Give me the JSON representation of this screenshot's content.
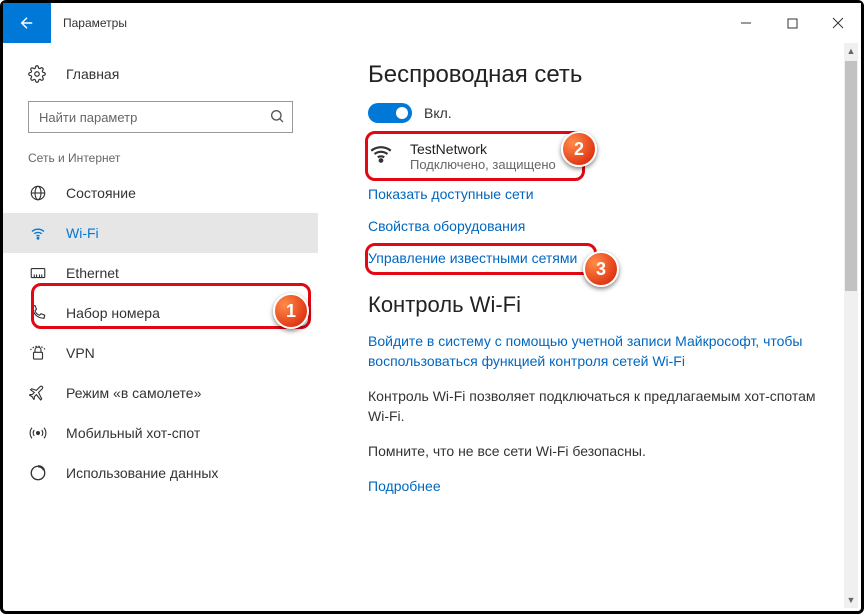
{
  "titlebar": {
    "title": "Параметры"
  },
  "sidebar": {
    "home_label": "Главная",
    "search_placeholder": "Найти параметр",
    "category_label": "Сеть и Интернет",
    "items": [
      {
        "label": "Состояние"
      },
      {
        "label": "Wi-Fi"
      },
      {
        "label": "Ethernet"
      },
      {
        "label": "Набор номера"
      },
      {
        "label": "VPN"
      },
      {
        "label": "Режим «в самолете»"
      },
      {
        "label": "Мобильный хот-спот"
      },
      {
        "label": "Использование данных"
      }
    ]
  },
  "main": {
    "heading1": "Беспроводная сеть",
    "toggle_label": "Вкл.",
    "network": {
      "name": "TestNetwork",
      "status": "Подключено, защищено"
    },
    "link_show_networks": "Показать доступные сети",
    "link_hw_props": "Свойства оборудования",
    "link_known_nets": "Управление известными сетями",
    "heading2": "Контроль Wi-Fi",
    "link_signin": "Войдите в систему с помощью учетной записи Майкрософт, чтобы воспользоваться функцией контроля сетей Wi-Fi",
    "body1": "Контроль Wi-Fi позволяет подключаться к предлагаемым хот-спотам Wi-Fi.",
    "body2": "Помните, что не все сети Wi-Fi безопасны.",
    "link_more": "Подробнее"
  },
  "annotations": {
    "b1": "1",
    "b2": "2",
    "b3": "3"
  }
}
